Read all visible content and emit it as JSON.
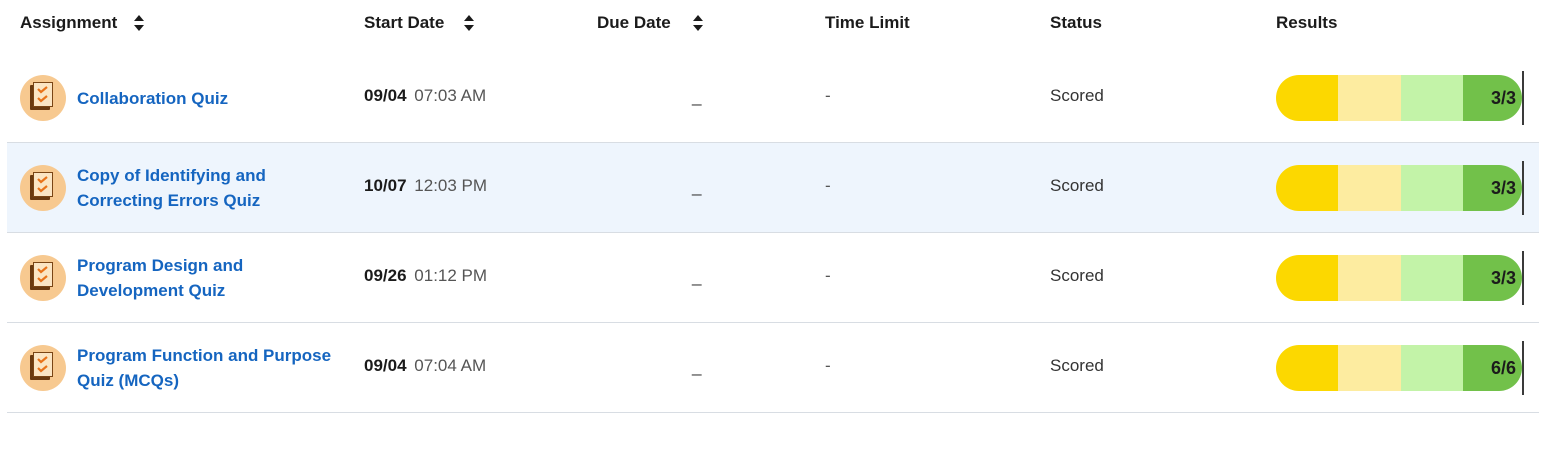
{
  "headers": {
    "assignment": "Assignment",
    "start_date": "Start Date",
    "due_date": "Due Date",
    "time_limit": "Time Limit",
    "status": "Status",
    "results": "Results"
  },
  "rows": [
    {
      "title": "Collaboration Quiz",
      "start_date": "09/04",
      "start_time": "07:03 AM",
      "due": "_",
      "time_limit": "-",
      "status": "Scored",
      "score": "3/3",
      "icon": "checklist-icon"
    },
    {
      "title": "Copy of Identifying and Correcting Errors Quiz",
      "start_date": "10/07",
      "start_time": "12:03 PM",
      "due": "_",
      "time_limit": "-",
      "status": "Scored",
      "score": "3/3",
      "icon": "checklist-icon"
    },
    {
      "title": "Program Design and Development Quiz",
      "start_date": "09/26",
      "start_time": "01:12 PM",
      "due": "_",
      "time_limit": "-",
      "status": "Scored",
      "score": "3/3",
      "icon": "checklist-icon"
    },
    {
      "title": "Program Function and Purpose Quiz (MCQs)",
      "start_date": "09/04",
      "start_time": "07:04 AM",
      "due": "_",
      "time_limit": "-",
      "status": "Scored",
      "score": "6/6",
      "icon": "checklist-icon"
    }
  ],
  "colors": {
    "link": "#1565c0",
    "row_highlight": "#eef5fd",
    "score_seg1": "#fcd800",
    "score_seg2": "#fdeca0",
    "score_seg3": "#c3f3a8",
    "score_seg4": "#72c14a"
  }
}
